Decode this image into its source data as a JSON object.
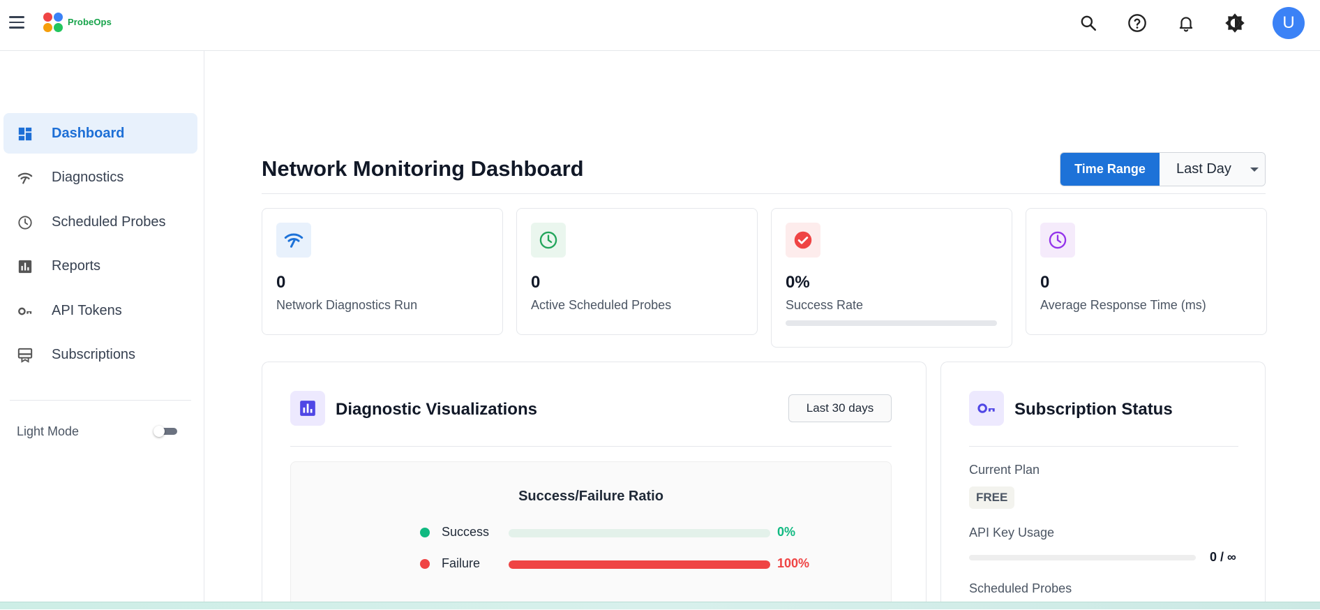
{
  "app": {
    "name": "ProbeOps",
    "avatar_initial": "U"
  },
  "topbar": {
    "icons": [
      "search-icon",
      "help-icon",
      "notifications-icon",
      "theme-icon"
    ]
  },
  "sidebar": {
    "items": [
      {
        "label": "Dashboard",
        "icon": "dashboard-icon",
        "active": true
      },
      {
        "label": "Diagnostics",
        "icon": "wifi-icon",
        "active": false
      },
      {
        "label": "Scheduled Probes",
        "icon": "clock-icon",
        "active": false
      },
      {
        "label": "Reports",
        "icon": "chart-icon",
        "active": false
      },
      {
        "label": "API Tokens",
        "icon": "key-icon",
        "active": false
      },
      {
        "label": "Subscriptions",
        "icon": "subscriptions-icon",
        "active": false
      }
    ],
    "mode_label": "Light Mode",
    "mode_toggle_on": false
  },
  "main": {
    "title": "Network Monitoring Dashboard",
    "time_range": {
      "label": "Time Range",
      "value": "Last Day"
    },
    "stats": [
      {
        "value": "0",
        "label": "Network Diagnostics Run",
        "icon": "wifi-icon",
        "color": "#1d72d8",
        "bg": "#e8f1fc"
      },
      {
        "value": "0",
        "label": "Active Scheduled Probes",
        "icon": "clock-icon",
        "color": "#22a55b",
        "bg": "#eaf6ee"
      },
      {
        "value": "0%",
        "label": "Success Rate",
        "icon": "check-circle-icon",
        "color": "#ef4444",
        "bg": "#fdecec",
        "progress": 0
      },
      {
        "value": "0",
        "label": "Average Response Time (ms)",
        "icon": "clock-icon",
        "color": "#9333ea",
        "bg": "#f5ebfb"
      }
    ],
    "visualizations": {
      "title": "Diagnostic Visualizations",
      "range_button": "Last 30 days",
      "chart_title": "Success/Failure Ratio",
      "rows": [
        {
          "name": "Success",
          "pct_label": "0%",
          "value": 0,
          "color": "#10b981"
        },
        {
          "name": "Failure",
          "pct_label": "100%",
          "value": 100,
          "color": "#ef4444"
        }
      ]
    },
    "subscription": {
      "title": "Subscription Status",
      "current_plan_label": "Current Plan",
      "plan": "FREE",
      "api_usage_label": "API Key Usage",
      "api_usage_value": "0 / ∞",
      "api_usage_fraction": 0,
      "scheduled_probes_label": "Scheduled Probes"
    }
  },
  "chart_data": {
    "type": "bar",
    "title": "Success/Failure Ratio",
    "categories": [
      "Success",
      "Failure"
    ],
    "values": [
      0,
      100
    ],
    "ylim": [
      0,
      100
    ]
  }
}
